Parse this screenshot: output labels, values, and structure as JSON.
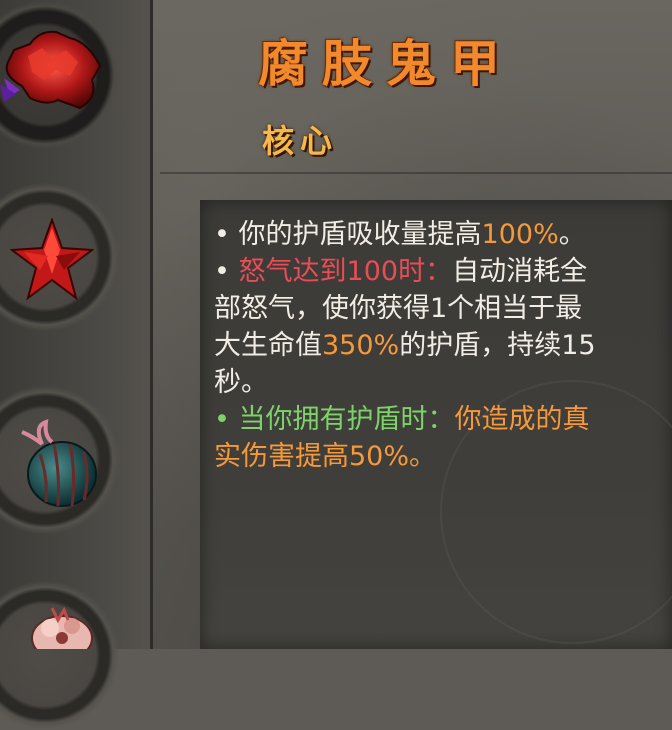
{
  "skill": {
    "name": "腐肢鬼甲",
    "category": "核心"
  },
  "description": {
    "line1": {
      "bullet": "•",
      "text": "你的护盾吸收量提高",
      "value": "100%",
      "end": "。"
    },
    "line2": {
      "bullet": "•",
      "condition": "怒气达到100时：",
      "text_a": "自动消耗全",
      "text_b": "部怒气，使你获得1个相当于最",
      "text_c_pre": "大生命值",
      "value": "350%",
      "text_c_post": "的护盾，持续15",
      "text_d": "秒。"
    },
    "line3": {
      "bullet": "•",
      "condition": "当你拥有护盾时：",
      "text_a": "你造成的真",
      "text_b": "实伤害提高50%。"
    }
  },
  "rail": {
    "items": [
      {
        "icon": "crimson-flesh-armor-icon",
        "active": true
      },
      {
        "icon": "red-crystal-star-icon",
        "active": false
      },
      {
        "icon": "striped-seed-pod-icon",
        "active": false
      },
      {
        "icon": "flesh-lump-icon",
        "active": false
      }
    ]
  },
  "colors": {
    "title": "#f08a2c",
    "subtitle": "#f5b84a",
    "highlight_orange": "#f5993a",
    "highlight_red": "#e84d55",
    "highlight_green": "#7dd36a",
    "body_text": "#f2ede4"
  }
}
